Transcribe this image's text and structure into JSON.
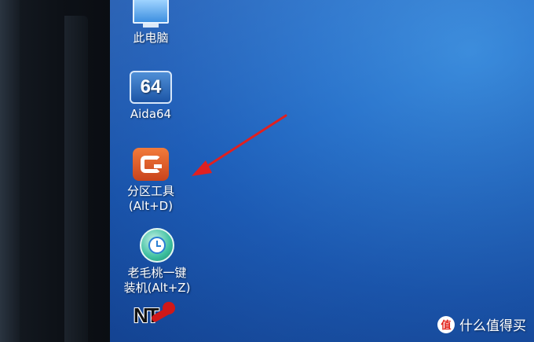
{
  "desktop": {
    "icons": [
      {
        "label": "此电脑",
        "icon": "this-pc-icon"
      },
      {
        "label": "Aida64",
        "glyph_text": "64",
        "icon": "aida64-icon"
      },
      {
        "label_line1": "分区工具",
        "label_line2": "(Alt+D)",
        "icon": "partition-tool-icon"
      },
      {
        "label_line1": "老毛桃一键",
        "label_line2": "装机(Alt+Z)",
        "icon": "one-key-install-icon"
      },
      {
        "glyph_text": "NT",
        "icon": "nt-password-key-icon"
      }
    ]
  },
  "annotation": {
    "color": "#e02020"
  },
  "watermark": {
    "badge": "值",
    "text": "什么值得买"
  },
  "colors": {
    "desktop_blue": "#2a74cc",
    "bezel": "#0d1117"
  }
}
